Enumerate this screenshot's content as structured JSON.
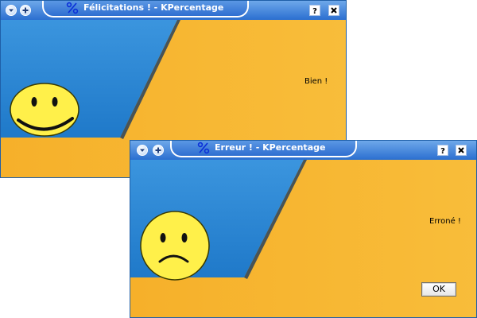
{
  "windows": [
    {
      "title": "Félicitations ! - KPercentage",
      "message": "Bien !",
      "mood": "happy"
    },
    {
      "title": "Erreur ! - KPercentage",
      "message": "Erroné !",
      "mood": "sad",
      "ok_label": "OK"
    }
  ],
  "colors": {
    "blue": "#2a7fd0",
    "orange": "#f7b52f",
    "face": "#fff04a",
    "title_blue": "#2f6fd1"
  },
  "icons": {
    "menu": "chevron-down-icon",
    "sticky": "plus-icon",
    "app": "percent-icon",
    "help": "help-icon",
    "close": "close-icon"
  }
}
